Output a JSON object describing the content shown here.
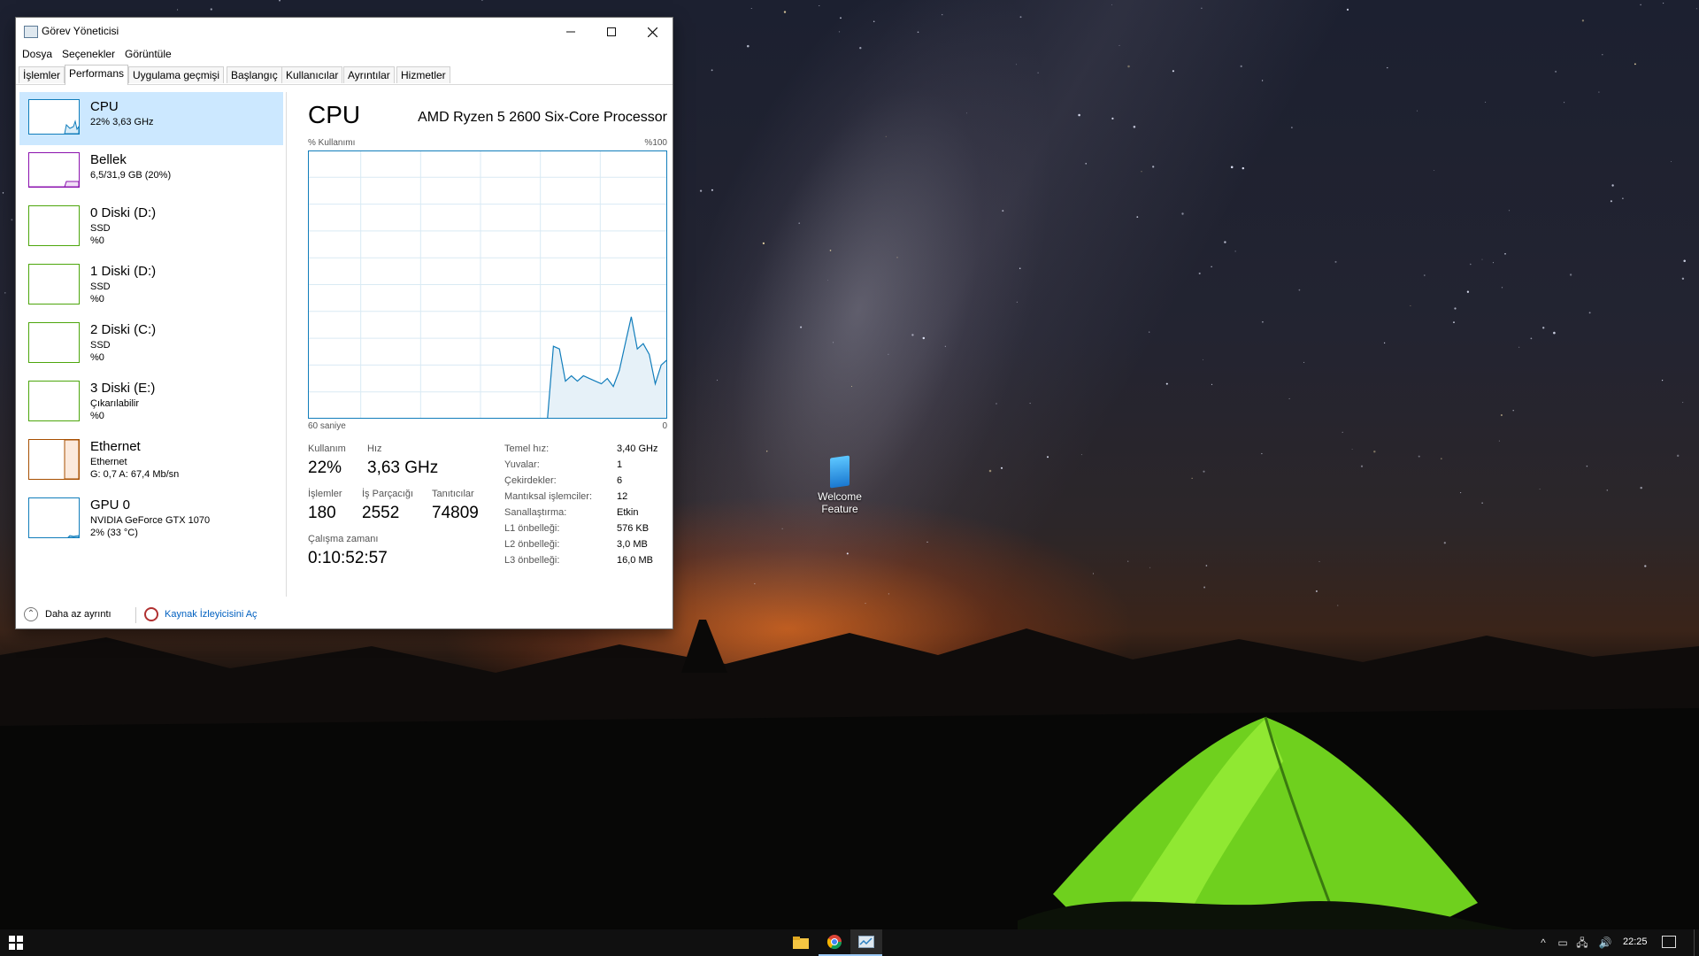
{
  "window": {
    "title": "Görev Yöneticisi",
    "menu": [
      "Dosya",
      "Seçenekler",
      "Görüntüle"
    ],
    "tabs": [
      "İşlemler",
      "Performans",
      "Uygulama geçmişi",
      "Başlangıç",
      "Kullanıcılar",
      "Ayrıntılar",
      "Hizmetler"
    ],
    "active_tab": "Performans"
  },
  "sidebar": {
    "items": [
      {
        "name": "CPU",
        "line1": "22% 3,63 GHz",
        "line2": "",
        "color": "#117dbb",
        "selected": true
      },
      {
        "name": "Bellek",
        "line1": "6,5/31,9 GB (20%)",
        "line2": "",
        "color": "#8b12ae",
        "selected": false
      },
      {
        "name": "0 Diski (D:)",
        "line1": "SSD",
        "line2": "%0",
        "color": "#4da60c",
        "selected": false
      },
      {
        "name": "1 Diski (D:)",
        "line1": "SSD",
        "line2": "%0",
        "color": "#4da60c",
        "selected": false
      },
      {
        "name": "2 Diski (C:)",
        "line1": "SSD",
        "line2": "%0",
        "color": "#4da60c",
        "selected": false
      },
      {
        "name": "3 Diski (E:)",
        "line1": "Çıkarılabilir",
        "line2": "%0",
        "color": "#4da60c",
        "selected": false
      },
      {
        "name": "Ethernet",
        "line1": "Ethernet",
        "line2": "G: 0,7 A: 67,4 Mb/sn",
        "color": "#a74f01",
        "selected": false
      },
      {
        "name": "GPU 0",
        "line1": "NVIDIA GeForce GTX 1070",
        "line2": "2% (33 °C)",
        "color": "#117dbb",
        "selected": false
      }
    ]
  },
  "detail": {
    "title": "CPU",
    "model": "AMD Ryzen 5 2600 Six-Core Processor",
    "graph_top_left": "% Kullanımı",
    "graph_top_right": "%100",
    "graph_bottom_left": "60 saniye",
    "graph_bottom_right": "0",
    "stats": {
      "usage_label": "Kullanım",
      "usage_value": "22%",
      "speed_label": "Hız",
      "speed_value": "3,63 GHz",
      "processes_label": "İşlemler",
      "processes_value": "180",
      "threads_label": "İş Parçacığı",
      "threads_value": "2552",
      "handles_label": "Tanıtıcılar",
      "handles_value": "74809",
      "uptime_label": "Çalışma zamanı",
      "uptime_value": "0:10:52:57"
    },
    "specs": [
      {
        "key": "Temel hız:",
        "value": "3,40 GHz"
      },
      {
        "key": "Yuvalar:",
        "value": "1"
      },
      {
        "key": "Çekirdekler:",
        "value": "6"
      },
      {
        "key": "Mantıksal işlemciler:",
        "value": "12"
      },
      {
        "key": "Sanallaştırma:",
        "value": "Etkin"
      },
      {
        "key": "L1 önbelleği:",
        "value": "576 KB"
      },
      {
        "key": "L2 önbelleği:",
        "value": "3,0 MB"
      },
      {
        "key": "L3 önbelleği:",
        "value": "16,0 MB"
      }
    ]
  },
  "chart_data": {
    "type": "area",
    "ylim": [
      0,
      100
    ],
    "x": [
      60,
      20,
      19,
      18,
      17,
      16,
      15,
      14,
      13,
      12,
      11,
      10,
      9,
      8,
      7,
      6,
      5,
      4,
      3,
      2,
      1,
      0
    ],
    "values": [
      0,
      0,
      27,
      26,
      14,
      16,
      14,
      16,
      15,
      14,
      13,
      15,
      12,
      18,
      28,
      38,
      26,
      28,
      24,
      13,
      20,
      22
    ],
    "color": "#117dbb"
  },
  "footer": {
    "fewer_details": "Daha az ayrıntı",
    "open_monitor": "Kaynak İzleyicisini Aç"
  },
  "desktop": {
    "icon_label": "Welcome Feature"
  },
  "taskbar": {
    "clock": "22:25",
    "apps": [
      "file-explorer-icon",
      "chrome-icon",
      "task-manager-icon"
    ]
  }
}
